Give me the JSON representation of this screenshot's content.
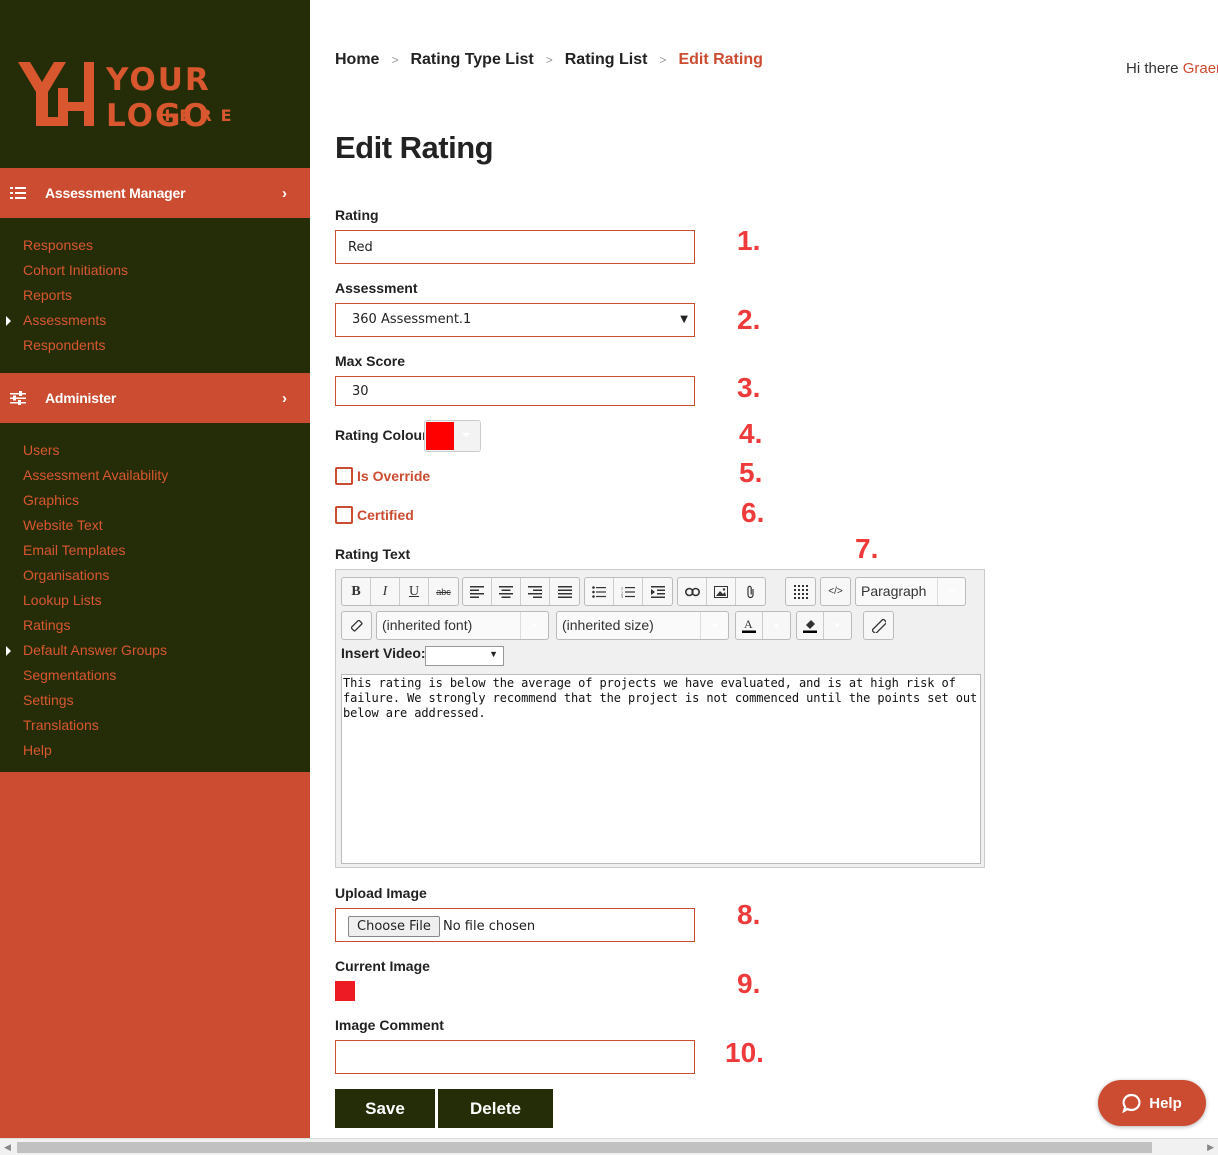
{
  "logo": {
    "line1": "YOUR LOGO",
    "line2": "HERE",
    "accent_color": "#d9572e"
  },
  "sidebar": {
    "bg_color": "#cb4c31",
    "dark_color": "#242d08",
    "sections": [
      {
        "title": "Assessment Manager",
        "icon": "list-icon",
        "items": [
          {
            "label": "Responses"
          },
          {
            "label": "Cohort Initiations"
          },
          {
            "label": "Reports"
          },
          {
            "label": "Assessments",
            "expandable": true
          },
          {
            "label": "Respondents"
          }
        ]
      },
      {
        "title": "Administer",
        "icon": "sliders-icon",
        "items": [
          {
            "label": "Users"
          },
          {
            "label": "Assessment Availability"
          },
          {
            "label": "Graphics"
          },
          {
            "label": "Website Text"
          },
          {
            "label": "Email Templates"
          },
          {
            "label": "Organisations"
          },
          {
            "label": "Lookup Lists"
          },
          {
            "label": "Ratings"
          },
          {
            "label": "Default Answer Groups",
            "expandable": true
          },
          {
            "label": "Segmentations"
          },
          {
            "label": "Settings"
          },
          {
            "label": "Translations"
          },
          {
            "label": "Help"
          }
        ]
      }
    ]
  },
  "breadcrumb": [
    "Home",
    "Rating Type List",
    "Rating List",
    "Edit Rating"
  ],
  "greeting": {
    "prefix": "Hi there ",
    "user": "Graer"
  },
  "page_title": "Edit Rating",
  "form": {
    "rating": {
      "label": "Rating",
      "value": "Red"
    },
    "assessment": {
      "label": "Assessment",
      "value": "360 Assessment.1"
    },
    "max_score": {
      "label": "Max Score",
      "value": "30"
    },
    "rating_colour": {
      "label": "Rating Colour",
      "value": "#ff0000"
    },
    "is_override": {
      "label": "Is Override",
      "checked": false
    },
    "certified": {
      "label": "Certified",
      "checked": false
    },
    "rating_text": {
      "label": "Rating Text",
      "font_select": "(inherited font)",
      "size_select": "(inherited size)",
      "block_select": "Paragraph",
      "insert_video_label": "Insert Video:",
      "content": "This rating is below the average of projects we have evaluated, and is at high risk of failure. We strongly recommend that the project is not commenced until the points set out below are addressed."
    },
    "upload_image": {
      "label": "Upload Image",
      "button": "Choose File",
      "status": "No file chosen"
    },
    "current_image": {
      "label": "Current Image",
      "color": "#ed1c24"
    },
    "image_comment": {
      "label": "Image Comment",
      "value": ""
    },
    "save_label": "Save",
    "delete_label": "Delete"
  },
  "annotations": [
    "1.",
    "2.",
    "3.",
    "4.",
    "5.",
    "6.",
    "7.",
    "8.",
    "9.",
    "10."
  ],
  "help_button": "Help"
}
